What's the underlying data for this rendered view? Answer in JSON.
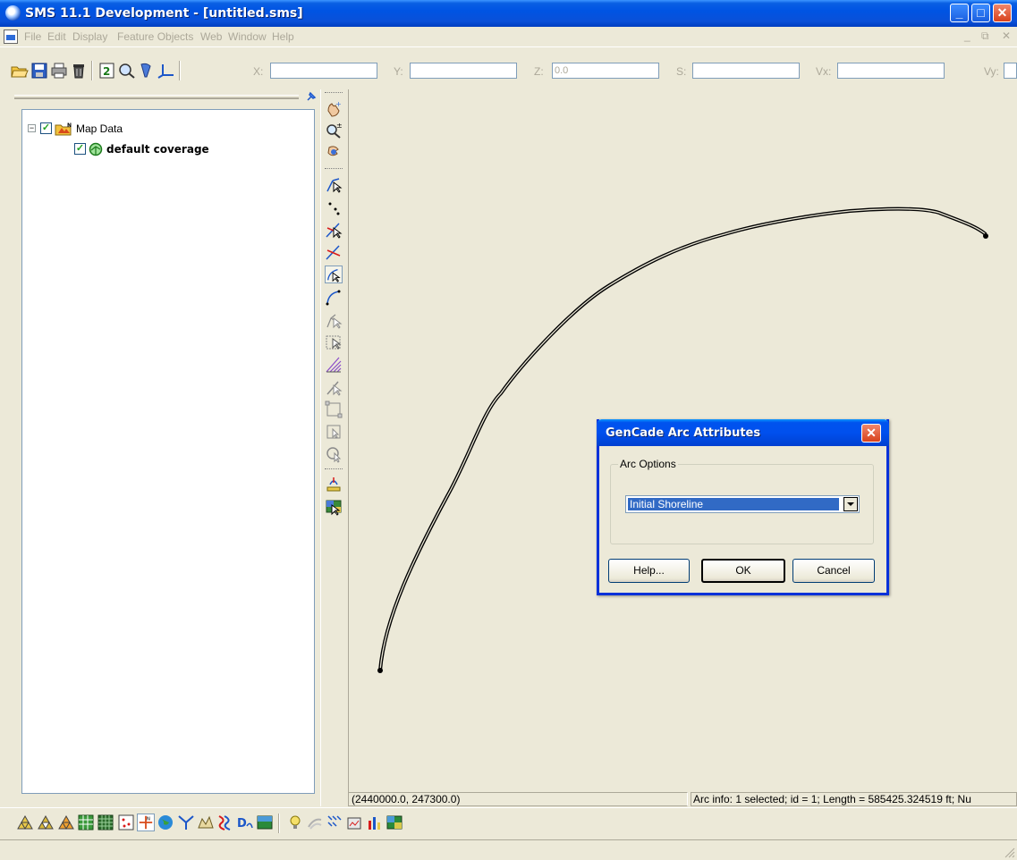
{
  "window": {
    "title": "SMS 11.1 Development - [untitled.sms]",
    "minimize_label": "_",
    "maximize_label": "□",
    "close_label": "✕"
  },
  "menu": {
    "items": [
      "File",
      "Edit",
      "Display",
      "Feature Objects",
      "Web",
      "Window",
      "Help"
    ],
    "mdi_min": "_",
    "mdi_restore": "⧉",
    "mdi_close": "✕"
  },
  "toolbar": {
    "icons": [
      "open-icon",
      "save-icon",
      "print-icon",
      "delete-icon",
      "refresh-icon",
      "zoom-frame-icon",
      "get-info-icon",
      "axis-icon"
    ],
    "coords": [
      {
        "label": "X:",
        "value": ""
      },
      {
        "label": "Y:",
        "value": ""
      },
      {
        "label": "Z:",
        "value": "0.0"
      },
      {
        "label": "S:",
        "value": ""
      },
      {
        "label": "Vx:",
        "value": ""
      },
      {
        "label": "Vy:",
        "value": ""
      }
    ]
  },
  "tree": {
    "root": {
      "label": "Map Data",
      "expanded": true,
      "checked": true
    },
    "children": [
      {
        "label": "default coverage",
        "checked": true,
        "active": true
      }
    ]
  },
  "palette": {
    "icons": [
      "pan-icon",
      "zoom-icon",
      "rotate-icon",
      "select-feature-point-icon",
      "create-feature-point-icon",
      "select-vertex-icon",
      "create-vertex-icon",
      "select-arc-icon",
      "create-arc-icon",
      "select-arc-group-icon",
      "select-polygon-icon",
      "create-arc-group-icon",
      "select-breakline-icon",
      "select-box-icon",
      "select-box-alt-icon",
      "select-zoom-icon",
      "frame-image-icon",
      "display-options-icon"
    ]
  },
  "graphics": {
    "arc_color": "#000000",
    "background": "#ece9d8"
  },
  "status": {
    "coords": "(2440000.0, 247300.0)",
    "arc_info": "Arc info: 1 selected; id = 1; Length = 585425.324519 ft; Nu"
  },
  "modules": {
    "icons": [
      "mesh-module-icon",
      "mesh-module-alt-icon",
      "mesh-module-2-icon",
      "cartesian-grid-icon",
      "grid-icon",
      "scatter-icon",
      "map-module-icon",
      "gis-module-icon",
      "particle-icon",
      "1d-grid-icon",
      "1d-river-icon",
      "tin-icon",
      "image-icon",
      "light-icon",
      "drawing-icon",
      "rain-icon",
      "raster-icon",
      "plot-icon",
      "raster-alt-icon"
    ]
  },
  "dialog": {
    "title": "GenCade Arc Attributes",
    "close_label": "✕",
    "group_label": "Arc Options",
    "selected_option": "Initial Shoreline",
    "buttons": {
      "help": "Help...",
      "ok": "OK",
      "cancel": "Cancel"
    }
  }
}
